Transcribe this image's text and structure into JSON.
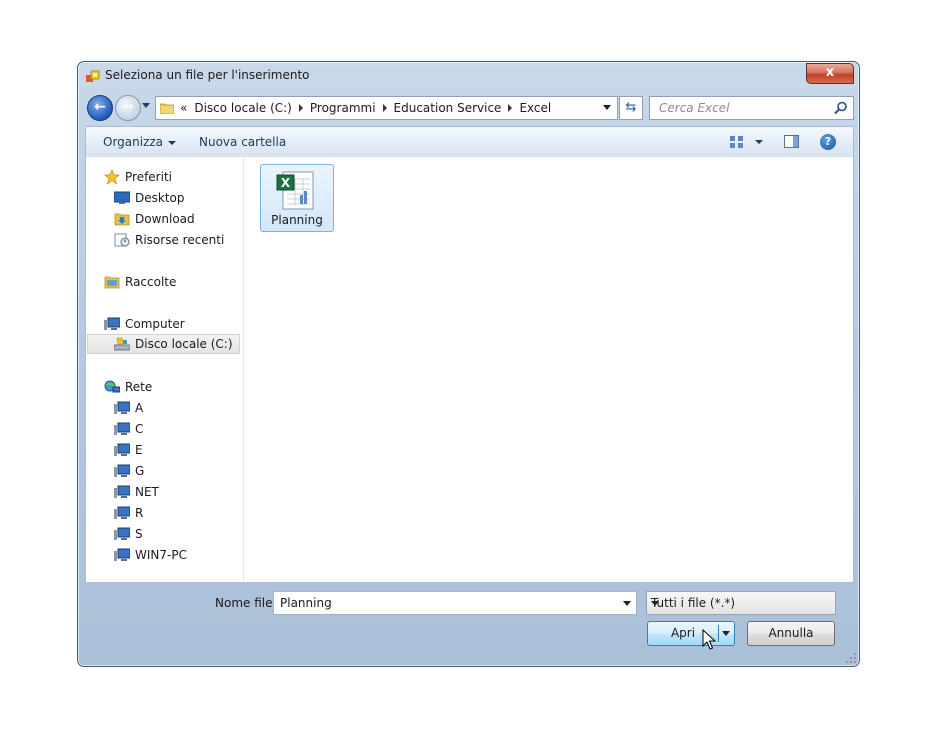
{
  "window": {
    "title": "Seleziona un file per l'inserimento",
    "close_label": "x"
  },
  "nav": {
    "back_icon": "back-arrow-icon",
    "forward_icon": "forward-arrow-icon"
  },
  "address": {
    "overflow": "«",
    "crumbs": [
      "Disco locale (C:)",
      "Programmi",
      "Education Service",
      "Excel"
    ]
  },
  "search": {
    "placeholder": "Cerca Excel"
  },
  "toolbar": {
    "organize_label": "Organizza",
    "new_folder_label": "Nuova cartella"
  },
  "sidebar": {
    "favorites": {
      "label": "Preferiti",
      "items": [
        "Desktop",
        "Download",
        "Risorse recenti"
      ]
    },
    "libraries": {
      "label": "Raccolte"
    },
    "computer": {
      "label": "Computer",
      "items": [
        "Disco locale (C:)"
      ]
    },
    "network": {
      "label": "Rete",
      "items": [
        "A",
        "C",
        "E",
        "G",
        "NET",
        "R",
        "S",
        "WIN7-PC"
      ]
    }
  },
  "files": [
    {
      "name": "Planning",
      "icon": "excel-file-icon",
      "selected": true
    }
  ],
  "bottom": {
    "filename_label": "Nome file:",
    "filename_value": "Planning",
    "filetype_value": "Tutti i file (*.*)",
    "open_label": "Apri",
    "cancel_label": "Annulla"
  },
  "colors": {
    "accent": "#2257b6",
    "selection": "#d3e7fb",
    "excel_green": "#1e7145"
  }
}
